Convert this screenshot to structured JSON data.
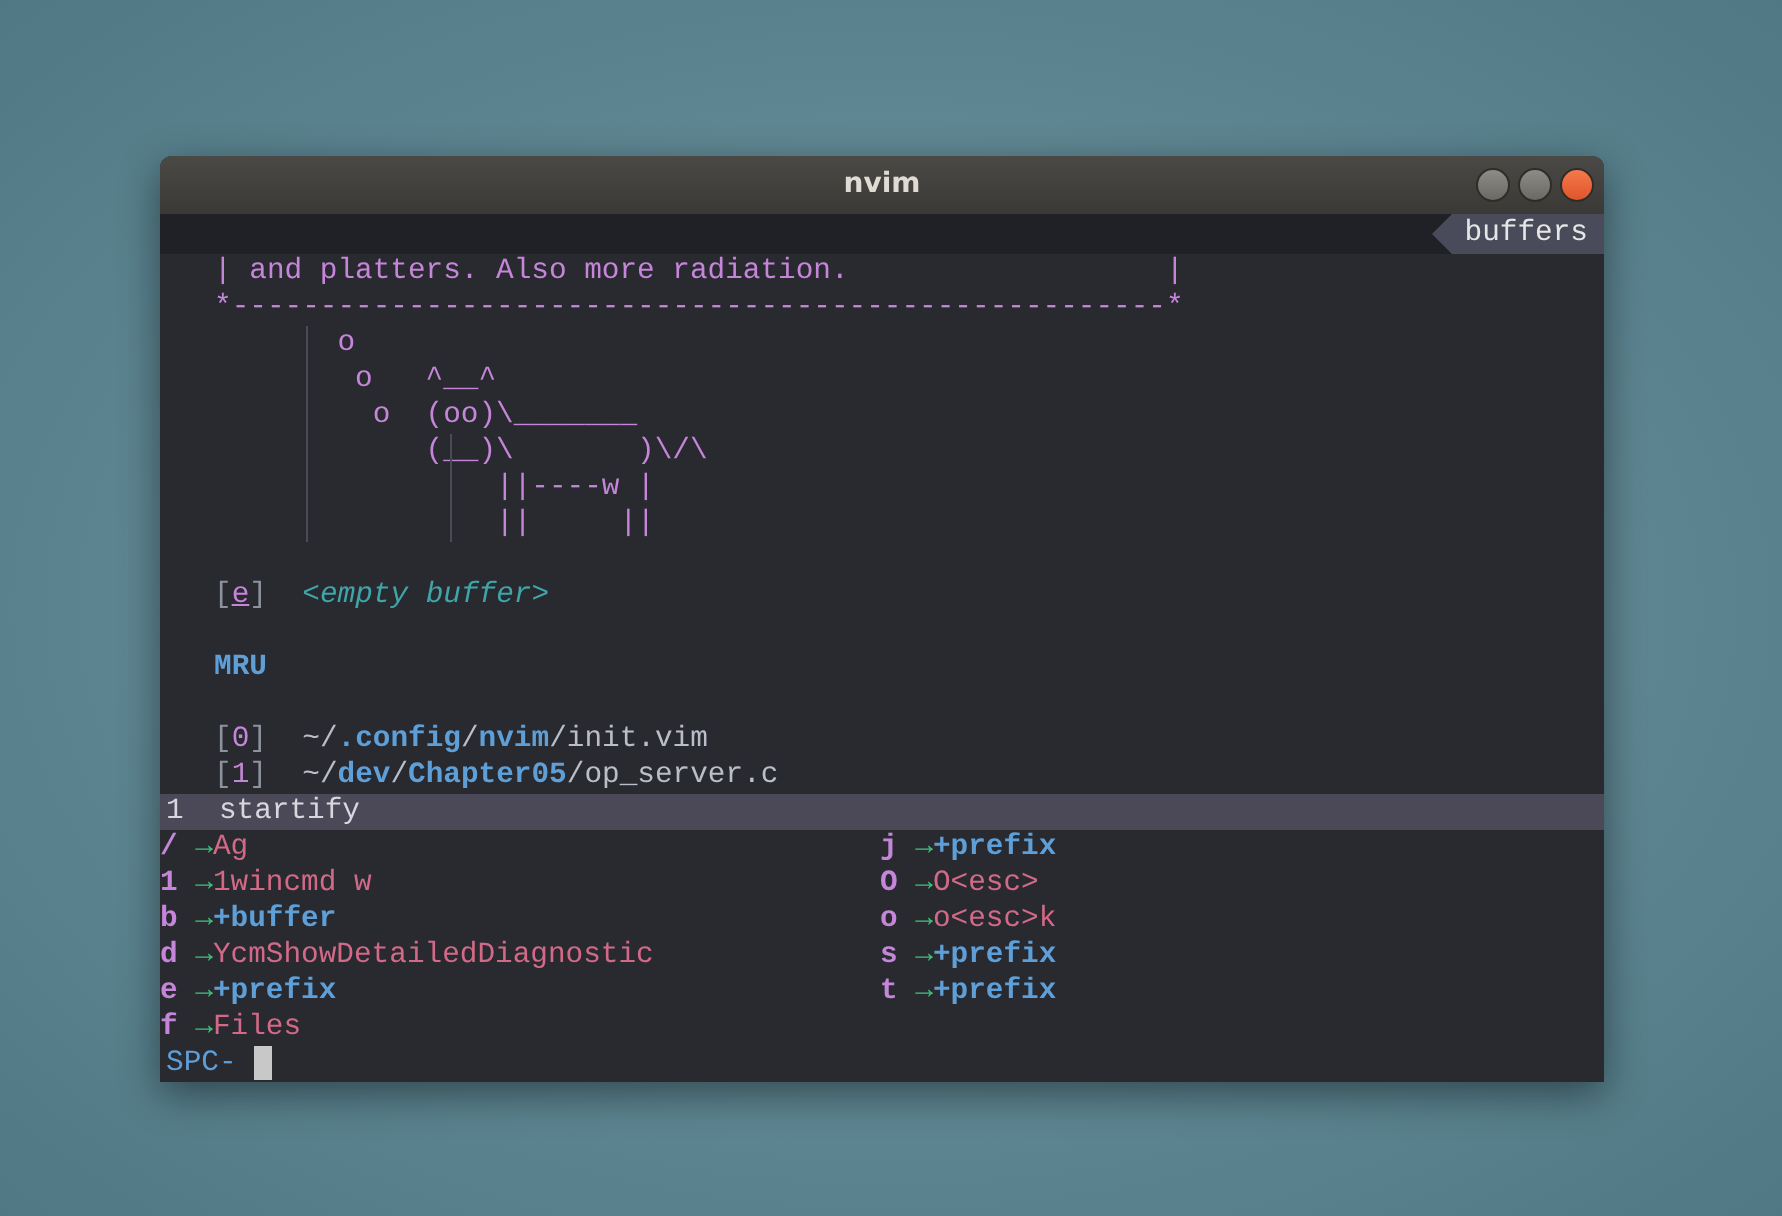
{
  "window": {
    "title": "nvim"
  },
  "tabline": {
    "label": "buffers"
  },
  "startify": {
    "header": [
      "| and platters. Also more radiation.                  |",
      "*-----------------------------------------------------*",
      "       o",
      "        o   ^__^",
      "         o  (oo)\\_______",
      "            (__)\\       )\\/\\",
      "                ||----w |",
      "                ||     ||"
    ],
    "empty_buffer": {
      "open": "[",
      "key": "e",
      "close": "]",
      "label": "<empty buffer>"
    },
    "section": "MRU",
    "mru": [
      {
        "open": "[",
        "index": "0",
        "close": "]",
        "path": "~/**.config**/**nvim**/init.vim"
      },
      {
        "open": "[",
        "index": "1",
        "close": "]",
        "path": "~/**dev**/**Chapter05**/op_server.c"
      }
    ]
  },
  "statusline": {
    "number": "1",
    "name": "startify"
  },
  "which_key": {
    "columns": [
      [
        {
          "key": "/",
          "arrow": "→",
          "kind": "command",
          "label": "Ag"
        },
        {
          "key": "1",
          "arrow": "→",
          "kind": "command",
          "label": "1wincmd w"
        },
        {
          "key": "b",
          "arrow": "→",
          "kind": "prefix",
          "label": "+buffer"
        },
        {
          "key": "d",
          "arrow": "→",
          "kind": "command",
          "label": "YcmShowDetailedDiagnostic"
        },
        {
          "key": "e",
          "arrow": "→",
          "kind": "prefix",
          "label": "+prefix"
        },
        {
          "key": "f",
          "arrow": "→",
          "kind": "command",
          "label": "Files"
        }
      ],
      [
        {
          "key": "j",
          "arrow": "→",
          "kind": "prefix",
          "label": "+prefix"
        },
        {
          "key": "O",
          "arrow": "→",
          "kind": "command",
          "label": "O<esc>"
        },
        {
          "key": "o",
          "arrow": "→",
          "kind": "command",
          "label": "o<esc>k"
        },
        {
          "key": "s",
          "arrow": "→",
          "kind": "prefix",
          "label": "+prefix"
        },
        {
          "key": "t",
          "arrow": "→",
          "kind": "prefix",
          "label": "+prefix"
        }
      ]
    ]
  },
  "cmdline": {
    "prompt": "SPC-"
  }
}
